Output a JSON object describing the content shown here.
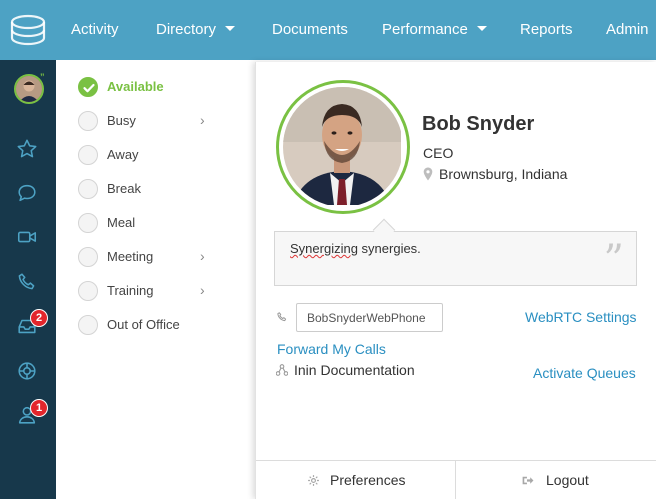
{
  "nav": {
    "items": [
      {
        "label": "Activity",
        "has_caret": false
      },
      {
        "label": "Directory",
        "has_caret": true
      },
      {
        "label": "Documents",
        "has_caret": false
      },
      {
        "label": "Performance",
        "has_caret": true
      },
      {
        "label": "Reports",
        "has_caret": false
      },
      {
        "label": "Admin",
        "has_caret": false
      }
    ],
    "background": "#4da2c4"
  },
  "rail": {
    "icons": [
      "avatar",
      "star-icon",
      "chat-icon",
      "video-icon",
      "phone-icon",
      "inbox-icon",
      "target-icon",
      "user-icon"
    ],
    "badges": {
      "inbox": "2",
      "user": "1"
    },
    "background": "#17384b"
  },
  "status_menu": {
    "items": [
      {
        "label": "Available",
        "checked": true,
        "has_submenu": false
      },
      {
        "label": "Busy",
        "checked": false,
        "has_submenu": true
      },
      {
        "label": "Away",
        "checked": false,
        "has_submenu": false
      },
      {
        "label": "Break",
        "checked": false,
        "has_submenu": false
      },
      {
        "label": "Meal",
        "checked": false,
        "has_submenu": false
      },
      {
        "label": "Meeting",
        "checked": false,
        "has_submenu": true
      },
      {
        "label": "Training",
        "checked": false,
        "has_submenu": true
      },
      {
        "label": "Out of Office",
        "checked": false,
        "has_submenu": false
      }
    ],
    "accent": "#7ac143"
  },
  "profile": {
    "name": "Bob Snyder",
    "title": "CEO",
    "location": "Brownsburg, Indiana",
    "status_message_misspelled": "Synergizing",
    "status_message_rest": " synergies.",
    "phone_value": "BobSnyderWebPhone",
    "webrtc_link": "WebRTC Settings",
    "forward_link": "Forward My Calls",
    "documentation": "Inin Documentation",
    "queues_link": "Activate Queues",
    "link_color": "#2a8fc1"
  },
  "footer": {
    "preferences": "Preferences",
    "logout": "Logout"
  }
}
